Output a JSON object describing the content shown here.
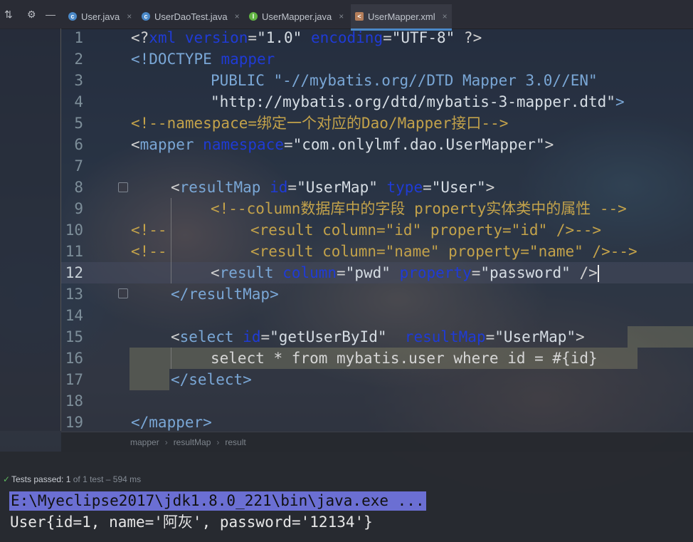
{
  "tabs": [
    {
      "label": "User.java",
      "icon": "java-class-icon",
      "color": "#4a88c7"
    },
    {
      "label": "UserDaoTest.java",
      "icon": "java-test-icon",
      "color": "#4a88c7"
    },
    {
      "label": "UserMapper.java",
      "icon": "java-interface-icon",
      "color": "#62b543"
    },
    {
      "label": "UserMapper.xml",
      "icon": "xml-file-icon",
      "color": "#b57e5a",
      "active": true
    }
  ],
  "gutter": {
    "line_numbers": [
      "1",
      "2",
      "3",
      "4",
      "5",
      "6",
      "7",
      "8",
      "9",
      "10",
      "11",
      "12",
      "13",
      "14",
      "15",
      "16",
      "17",
      "18",
      "19"
    ],
    "current_line": "12"
  },
  "code": {
    "l1": {
      "pi_open": "<?",
      "xml": "xml",
      "version": "version",
      "eq1": "=",
      "v10": "\"1.0\"",
      "encoding": "encoding",
      "eq2": "=",
      "utf": "\"UTF-8\"",
      "pi_close": "?>"
    },
    "l2": {
      "doctype": "<!DOCTYPE",
      "mapper": "mapper"
    },
    "l3": {
      "text": "PUBLIC \"-//mybatis.org//DTD Mapper 3.0//EN\""
    },
    "l4": {
      "text": "\"http://mybatis.org/dtd/mybatis-3-mapper.dtd\"",
      "close": ">"
    },
    "l5": {
      "text": "<!--namespace=绑定一个对应的Dao/Mapper接口-->"
    },
    "l6": {
      "open": "<",
      "tag": "mapper",
      "attr": "namespace",
      "eq": "=",
      "val": "\"com.onlylmf.dao.UserMapper\"",
      "close": ">"
    },
    "l8": {
      "open": "<",
      "tag": "resultMap",
      "a1": "id",
      "v1": "\"UserMap\"",
      "a2": "type",
      "v2": "\"User\"",
      "close": ">"
    },
    "l9": {
      "text": "<!--column数据库中的字段 property实体类中的属性 -->"
    },
    "l10": {
      "prefix": "<!--",
      "text": "<result column=\"id\" property=\"id\" />-->"
    },
    "l11": {
      "prefix": "<!--",
      "text": "<result column=\"name\" property=\"name\" />-->"
    },
    "l12": {
      "open": "<",
      "tag": "result",
      "a1": "column",
      "v1": "\"pwd\"",
      "a2": "property",
      "v2": "\"password\"",
      "close": " />"
    },
    "l13": {
      "text": "</resultMap>"
    },
    "l15": {
      "open": "<",
      "tag": "select",
      "a1": "id",
      "v1": "\"getUserById\"",
      "a2": "resultMap",
      "v2": "\"UserMap\"",
      "close": ">"
    },
    "l16": {
      "text": "select * from mybatis.user where id = #{id}"
    },
    "l17": {
      "text": "</select>"
    },
    "l19": {
      "text": "</mapper>"
    }
  },
  "breadcrumb": [
    "mapper",
    "resultMap",
    "result"
  ],
  "run": {
    "status_label": "Tests passed:",
    "status_count": "1",
    "status_detail": "of 1 test – 594 ms",
    "command": "E:\\Myeclipse2017\\jdk1.8.0_221\\bin\\java.exe ...",
    "output": "User{id=1, name='阿灰', password='12134'}"
  }
}
